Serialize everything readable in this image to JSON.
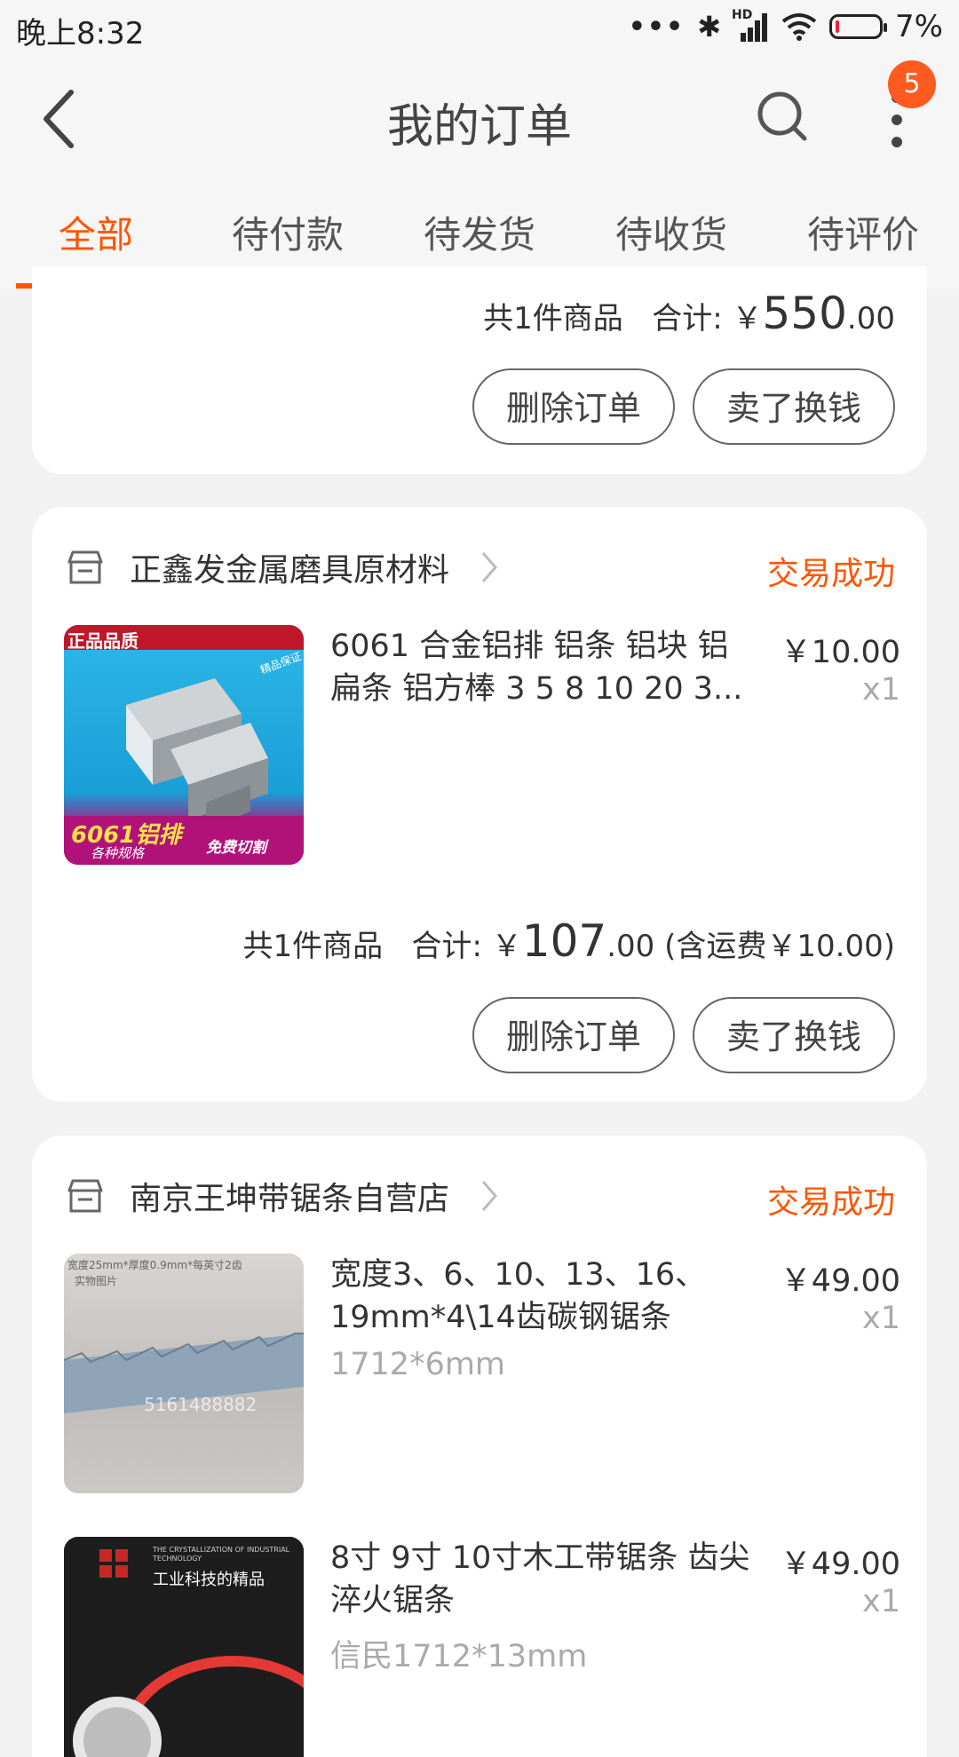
{
  "status": {
    "time": "晚上8:32",
    "dots": "•••",
    "bluetooth": "✱",
    "hd": "HD",
    "battery_percent": "7%",
    "battery_level": 0.07
  },
  "header": {
    "title": "我的订单",
    "badge": "5"
  },
  "tabs": [
    {
      "label": "全部"
    },
    {
      "label": "待付款"
    },
    {
      "label": "待发货"
    },
    {
      "label": "待收货"
    },
    {
      "label": "待评价"
    }
  ],
  "orders": [
    {
      "summary_count": "共1件商品",
      "summary_total_label": "合计: ",
      "currency": "￥",
      "total_int": "550",
      "total_dec": ".00",
      "actions": {
        "delete": "删除订单",
        "sell": "卖了换钱"
      }
    },
    {
      "shop": "正鑫发金属磨具原材料",
      "status": "交易成功",
      "items": [
        {
          "title": "6061 合金铝排 铝条 铝块 铝扁条 铝方棒 3 5 8 10 20 3...",
          "price": "￥10.00",
          "qty": "x1",
          "image_texts": {
            "top": "正品品质",
            "corner": "精品保证",
            "main": "6061铝排",
            "sub": "各种规格",
            "cut": "免费切割"
          }
        }
      ],
      "summary_count": "共1件商品",
      "summary_total_label": "合计: ",
      "currency": "￥",
      "total_int": "107",
      "total_dec": ".00",
      "shipping": "(含运费￥10.00)",
      "actions": {
        "delete": "删除订单",
        "sell": "卖了换钱"
      }
    },
    {
      "shop": "南京王坤带锯条自营店",
      "status": "交易成功",
      "items": [
        {
          "title": "宽度3、6、10、13、16、19mm*4\\14齿碳钢锯条",
          "sku": "1712*6mm",
          "price": "￥49.00",
          "qty": "x1",
          "image_texts": {
            "caption": "宽度25mm*厚度0.9mm*每英寸2齿",
            "caption2": "实物图片",
            "watermark": "5161488882"
          }
        },
        {
          "title": "8寸 9寸 10寸木工带锯条 齿尖淬火锯条",
          "sku": "信民1712*13mm",
          "price": "￥49.00",
          "qty": "x1",
          "image_texts": {
            "en": "THE CRYSTALLIZATION OF INDUSTRIAL TECHNOLOGY",
            "cn": "工业科技的精品"
          }
        }
      ]
    }
  ]
}
